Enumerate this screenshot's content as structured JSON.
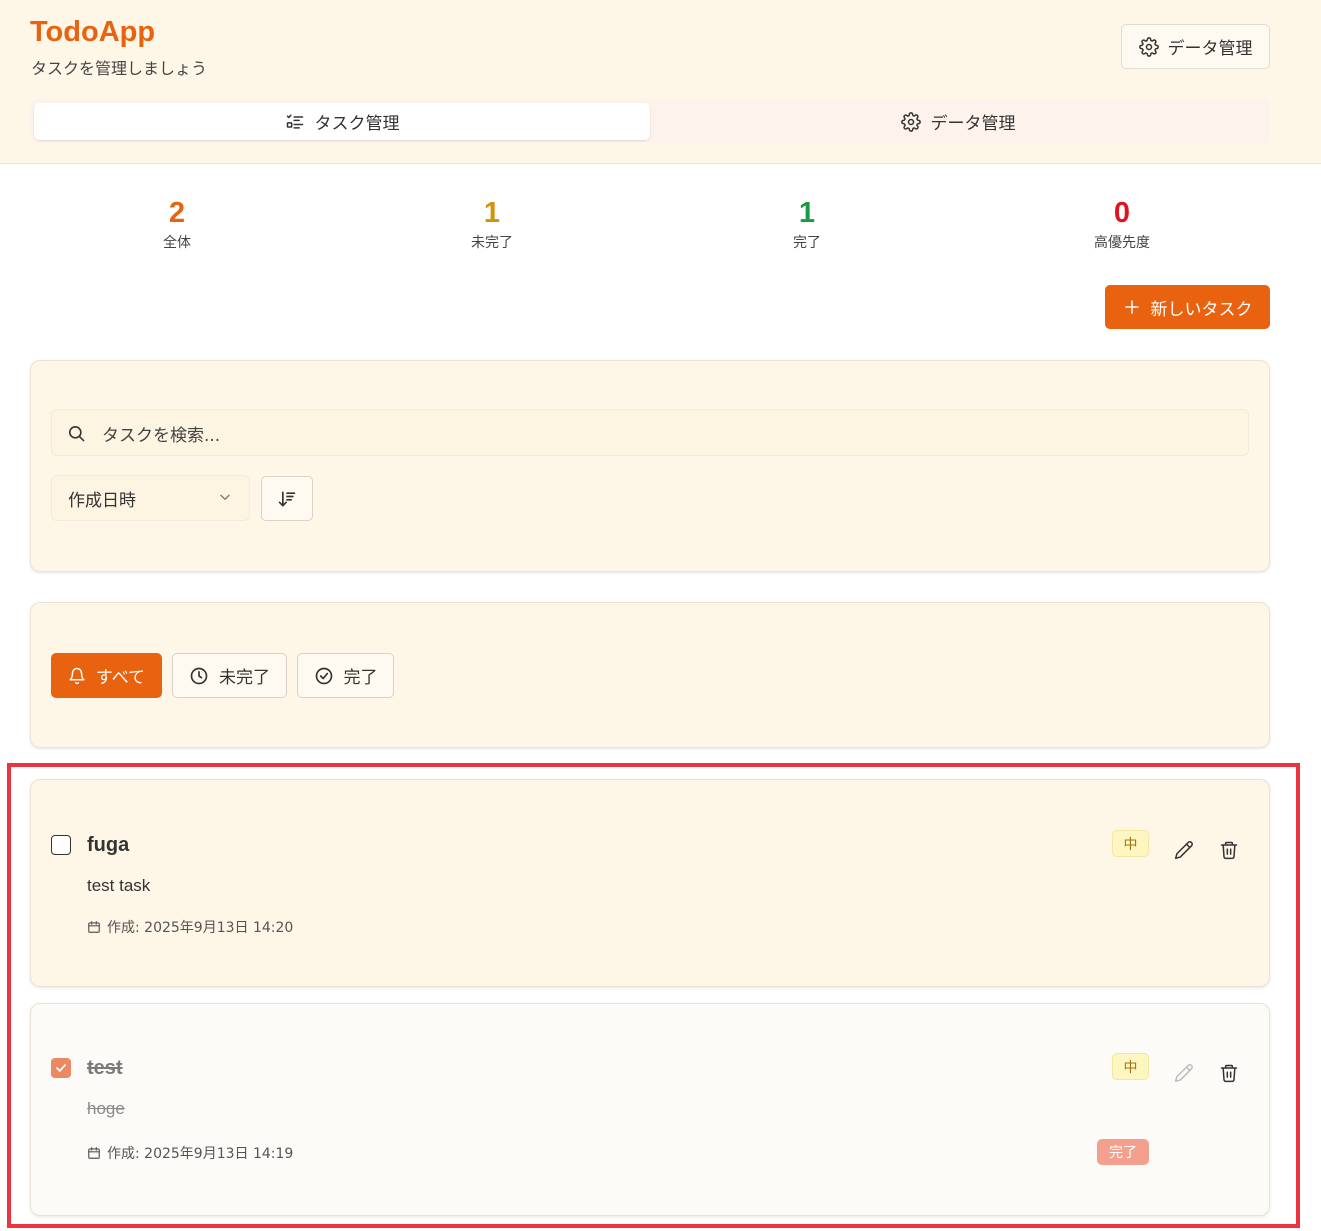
{
  "header": {
    "title": "TodoApp",
    "subtitle": "タスクを管理しましょう",
    "data_button_label": "データ管理"
  },
  "tabs": [
    {
      "label": "タスク管理",
      "active": true,
      "icon": "list-check-icon"
    },
    {
      "label": "データ管理",
      "active": false,
      "icon": "gear-icon"
    }
  ],
  "stats": [
    {
      "value": "2",
      "label": "全体",
      "color": "#e8620f"
    },
    {
      "value": "1",
      "label": "未完了",
      "color": "#d4920a"
    },
    {
      "value": "1",
      "label": "完了",
      "color": "#1e9a46"
    },
    {
      "value": "0",
      "label": "高優先度",
      "color": "#e0141c"
    }
  ],
  "new_task_button": "新しいタスク",
  "search": {
    "placeholder": "タスクを検索...",
    "sort_value": "作成日時"
  },
  "filters": [
    {
      "label": "すべて",
      "active": true,
      "icon": "bell-icon"
    },
    {
      "label": "未完了",
      "active": false,
      "icon": "clock-icon"
    },
    {
      "label": "完了",
      "active": false,
      "icon": "check-circle-icon"
    }
  ],
  "tasks": [
    {
      "title": "fuga",
      "description": "test task",
      "created": "作成: 2025年9月13日 14:20",
      "priority": "中",
      "completed": false
    },
    {
      "title": "test",
      "description": "hoge",
      "created": "作成: 2025年9月13日 14:19",
      "priority": "中",
      "completed": true,
      "status_badge": "完了"
    }
  ],
  "colors": {
    "accent": "#e8620f",
    "header_bg": "#fef6e7",
    "highlight": "#ee3340"
  }
}
